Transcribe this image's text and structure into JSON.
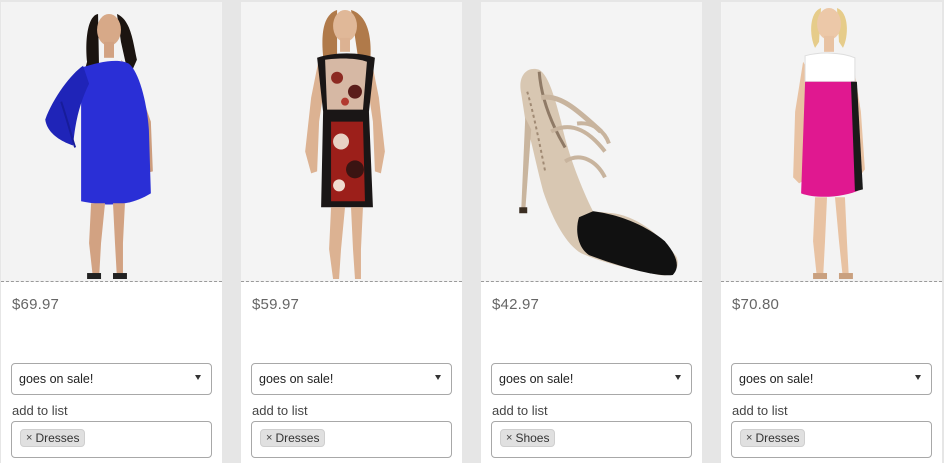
{
  "products": [
    {
      "price": "$69.97",
      "product_image": "blue-one-shoulder-dress",
      "alert_selected": "goes on sale!",
      "add_to_list_label": "add to list",
      "tags": [
        {
          "remove": "×",
          "label": "Dresses"
        }
      ]
    },
    {
      "price": "$59.97",
      "product_image": "floral-print-sheath-dress",
      "alert_selected": "goes on sale!",
      "add_to_list_label": "add to list",
      "tags": [
        {
          "remove": "×",
          "label": "Dresses"
        }
      ]
    },
    {
      "price": "$42.97",
      "product_image": "snakeskin-pointed-pump",
      "alert_selected": "goes on sale!",
      "add_to_list_label": "add to list",
      "tags": [
        {
          "remove": "×",
          "label": "Shoes"
        }
      ]
    },
    {
      "price": "$70.80",
      "product_image": "pink-colorblock-shift-dress",
      "alert_selected": "goes on sale!",
      "add_to_list_label": "add to list",
      "tags": [
        {
          "remove": "×",
          "label": "Dresses"
        }
      ]
    }
  ],
  "colors": {
    "page_bg": "#e6e6e6",
    "card_bg": "#ffffff",
    "price_text": "#666666",
    "tag_bg": "#e0e0e0",
    "dress_blue": "#2a2fd6",
    "dress_pink": "#e01890"
  }
}
